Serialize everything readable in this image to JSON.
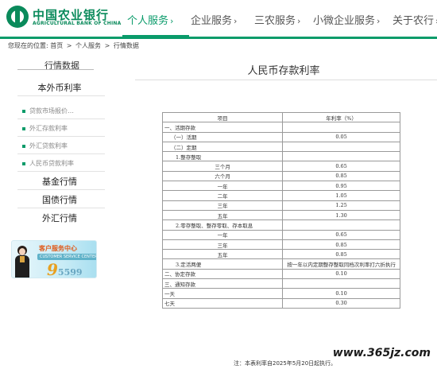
{
  "header": {
    "logo_cn": "中国农业银行",
    "logo_en": "AGRICULTURAL BANK OF CHINA",
    "nav": [
      {
        "label": "个人服务",
        "chev": "›",
        "active": true
      },
      {
        "label": "企业服务",
        "chev": "›",
        "active": false
      },
      {
        "label": "三农服务",
        "chev": "›",
        "active": false
      },
      {
        "label": "小微企业服务",
        "chev": "›",
        "active": false
      },
      {
        "label": "关于农行",
        "chev": "›",
        "active": false
      }
    ],
    "accent_color": "#0a9b6a"
  },
  "breadcrumb": {
    "prefix": "您现在的位置:",
    "items": [
      "首页",
      "个人服务",
      "行情数据"
    ],
    "separator": ">"
  },
  "sidebar": {
    "title": "行情数据",
    "group_head": "本外币利率",
    "sub_items": [
      "贷款市场报价…",
      "外汇存款利率",
      "外汇贷款利率",
      "人民币贷款利率"
    ],
    "sections": [
      "基金行情",
      "国债行情",
      "外汇行情"
    ],
    "banner": {
      "title": "客户服务中心",
      "en": "CUSTOMER SERVICE CENTER",
      "number_big": "9",
      "number_small": "5599"
    }
  },
  "main": {
    "title": "人民币存款利率",
    "table": {
      "headers": [
        "项目",
        "年利率（%）"
      ],
      "rows": [
        [
          "一、活期存款",
          ""
        ],
        [
          "（一）活期",
          "0.05"
        ],
        [
          "（二）定期",
          ""
        ],
        [
          "1.整存整取",
          ""
        ],
        [
          "三个月",
          "0.65"
        ],
        [
          "六个月",
          "0.85"
        ],
        [
          "一年",
          "0.95"
        ],
        [
          "二年",
          "1.05"
        ],
        [
          "三年",
          "1.25"
        ],
        [
          "五年",
          "1.30"
        ],
        [
          "2.零存整取、整存零取、存本取息",
          ""
        ],
        [
          "一年",
          "0.65"
        ],
        [
          "三年",
          "0.85"
        ],
        [
          "五年",
          "0.85"
        ],
        [
          "3.定活两便",
          "按一年以内定期整存整取同档次利率打六折执行"
        ],
        [
          "二、协定存款",
          "0.10"
        ],
        [
          "三、通知存款",
          ""
        ],
        [
          "一天",
          "0.10"
        ],
        [
          "七天",
          "0.30"
        ]
      ]
    },
    "note": "注：本表利率自2025年5月20日起执行。"
  },
  "watermark": "www.365jz.com"
}
